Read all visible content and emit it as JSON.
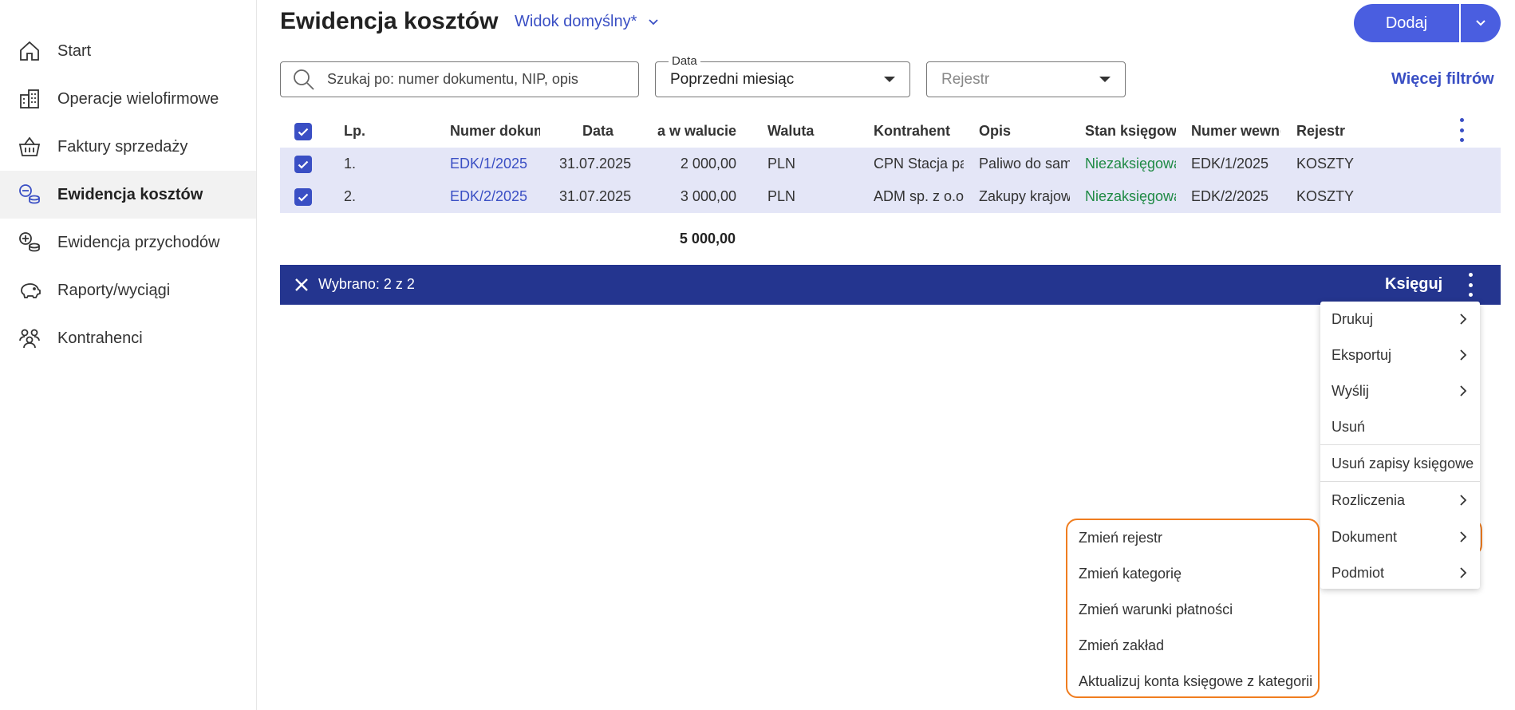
{
  "sidebar": {
    "items": [
      {
        "label": "Start",
        "icon": "home-icon"
      },
      {
        "label": "Operacje wielofirmowe",
        "icon": "buildings-icon"
      },
      {
        "label": "Faktury sprzedaży",
        "icon": "basket-icon"
      },
      {
        "label": "Ewidencja kosztów",
        "icon": "coins-minus-icon"
      },
      {
        "label": "Ewidencja przychodów",
        "icon": "coins-plus-icon"
      },
      {
        "label": "Raporty/wyciągi",
        "icon": "piggy-bank-icon"
      },
      {
        "label": "Kontrahenci",
        "icon": "people-icon"
      }
    ]
  },
  "header": {
    "title": "Ewidencja kosztów",
    "view": "Widok domyślny*",
    "add_label": "Dodaj"
  },
  "filters": {
    "search_placeholder": "Szukaj po: numer dokumentu, NIP, opis",
    "date_label": "Data",
    "date_value": "Poprzedni miesiąc",
    "register_placeholder": "Rejestr",
    "more_filters": "Więcej filtrów"
  },
  "table": {
    "columns": [
      "Lp.",
      "Numer dokum",
      "Data",
      "a w walucie",
      "Waluta",
      "Kontrahent",
      "Opis",
      "Stan księgowa",
      "Numer wewnę",
      "Rejestr"
    ],
    "rows": [
      {
        "lp": "1.",
        "number": "EDK/1/2025",
        "date": "31.07.2025",
        "amount": "2 000,00",
        "currency": "PLN",
        "contractor": "CPN Stacja pa",
        "description": "Paliwo do sam",
        "status": "Niezaksięgowa",
        "internal": "EDK/1/2025",
        "register": "KOSZTY"
      },
      {
        "lp": "2.",
        "number": "EDK/2/2025",
        "date": "31.07.2025",
        "amount": "3 000,00",
        "currency": "PLN",
        "contractor": "ADM sp. z o.o.",
        "description": "Zakupy krajow",
        "status": "Niezaksięgowa",
        "internal": "EDK/2/2025",
        "register": "KOSZTY"
      }
    ],
    "total": "5 000,00"
  },
  "selection": {
    "text": "Wybrano: 2 z 2",
    "post_label": "Księguj"
  },
  "menu": {
    "items": [
      {
        "label": "Drukuj",
        "submenu": true
      },
      {
        "label": "Eksportuj",
        "submenu": true
      },
      {
        "label": "Wyślij",
        "submenu": true
      },
      {
        "label": "Usuń",
        "submenu": false
      },
      {
        "label": "Usuń zapisy księgowe",
        "submenu": false
      },
      {
        "label": "Rozliczenia",
        "submenu": true
      },
      {
        "label": "Dokument",
        "submenu": true
      },
      {
        "label": "Podmiot",
        "submenu": true
      }
    ]
  },
  "submenu": {
    "items": [
      "Zmień rejestr",
      "Zmień kategorię",
      "Zmień warunki płatności",
      "Zmień zakład",
      "Aktualizuj konta księgowe z kategorii"
    ]
  },
  "colors": {
    "accent": "#4a5ee0",
    "selection_bar": "#24358f",
    "row_selected": "#e4e6f7",
    "status_green": "#1f8a45",
    "highlight": "#f07d1f"
  }
}
